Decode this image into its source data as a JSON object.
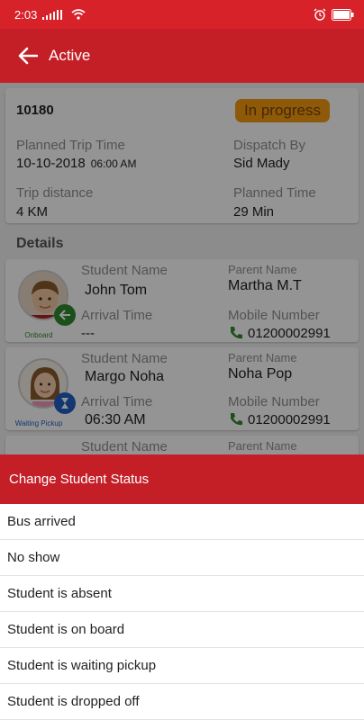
{
  "status_bar": {
    "time": "2:03"
  },
  "app_bar": {
    "title": "Active"
  },
  "trip": {
    "id": "10180",
    "status": "In progress",
    "planned_trip_time_label": "Planned Trip Time",
    "planned_trip_date": "10-10-2018",
    "planned_trip_hour": "06:00 AM",
    "dispatch_by_label": "Dispatch By",
    "dispatch_by": "Sid Mady",
    "trip_distance_label": "Trip distance",
    "trip_distance": "4 KM",
    "planned_time_label": "Planned Time",
    "planned_time": "29 Min"
  },
  "details": {
    "heading": "Details",
    "students": [
      {
        "student_name_label": "Student Name",
        "student_name": "John Tom",
        "arrival_time_label": "Arrival Time",
        "arrival_time": "---",
        "parent_name_label": "Parent Name",
        "parent_name": "Martha M.T",
        "mobile_label": "Mobile Number",
        "mobile": "01200002991",
        "status_label": "Onboard",
        "status_color": "#2f8a2f"
      },
      {
        "student_name_label": "Student Name",
        "student_name": "Margo Noha",
        "arrival_time_label": "Arrival Time",
        "arrival_time": "06:30 AM",
        "parent_name_label": "Parent Name",
        "parent_name": "Noha Pop",
        "mobile_label": "Mobile Number",
        "mobile": "01200002991",
        "status_label": "Waiting Pickup",
        "status_color": "#1f5fc4"
      },
      {
        "student_name_label": "Student Name",
        "parent_name_label": "Parent Name"
      }
    ]
  },
  "sheet": {
    "title": "Change Student Status",
    "options": [
      "Bus arrived",
      "No show",
      "Student is absent",
      "Student is on board",
      "Student is waiting pickup",
      "Student is dropped off"
    ]
  },
  "colors": {
    "primary": "#c41f27",
    "status_bar": "#d8222a",
    "badge": "#f59b12"
  }
}
